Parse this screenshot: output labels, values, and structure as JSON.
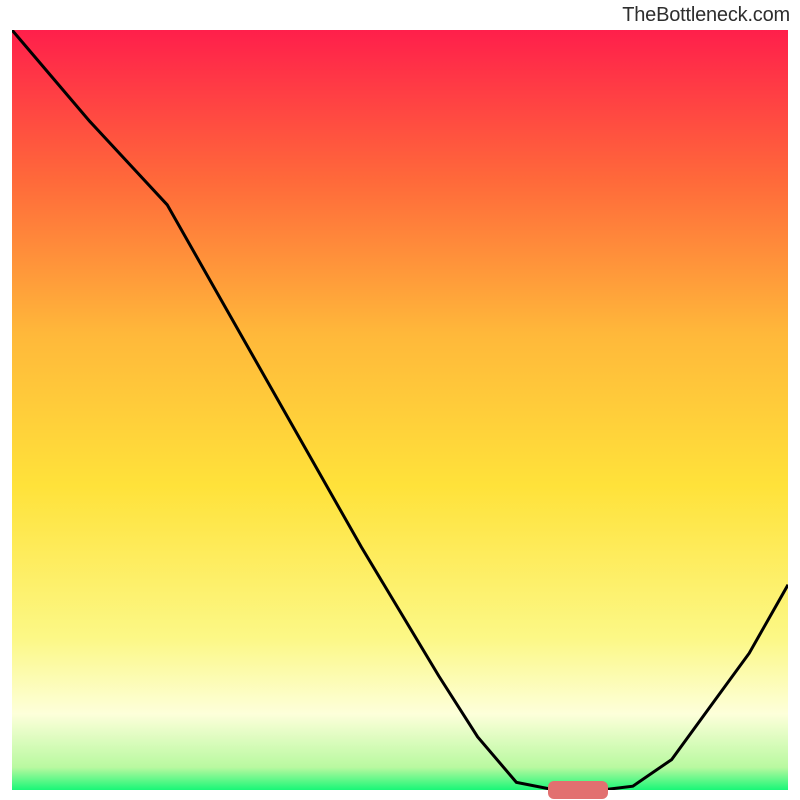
{
  "attribution": "TheBottleneck.com",
  "chart_data": {
    "type": "line",
    "x": [
      0.0,
      0.05,
      0.1,
      0.15,
      0.2,
      0.25,
      0.3,
      0.35,
      0.4,
      0.45,
      0.5,
      0.55,
      0.6,
      0.65,
      0.7,
      0.72,
      0.76,
      0.8,
      0.85,
      0.9,
      0.95,
      1.0
    ],
    "y": [
      100,
      94,
      88,
      82.5,
      77,
      68,
      59,
      50,
      41,
      32,
      23.5,
      15,
      7,
      1,
      0,
      0,
      0,
      0.5,
      4,
      11,
      18,
      27
    ],
    "title": "",
    "xlabel": "",
    "ylabel": "",
    "xlim": [
      0,
      1
    ],
    "ylim": [
      0,
      100
    ],
    "background_gradient": {
      "top": "#ff1f4b",
      "0.20": "#ff6a3a",
      "0.40": "#ffb83a",
      "0.60": "#ffe23a",
      "0.80": "#fcf886",
      "0.90": "#fdffda",
      "bottom": "#19f777"
    },
    "marker": {
      "x": 0.73,
      "y": 0,
      "color": "#e27070"
    },
    "line_color": "#000000"
  }
}
